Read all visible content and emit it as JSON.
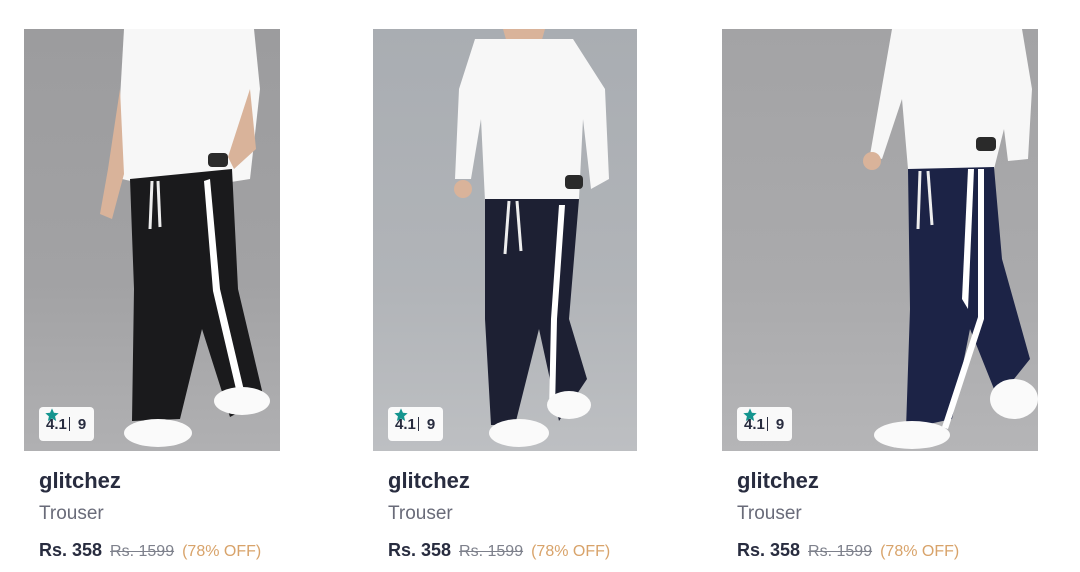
{
  "products": [
    {
      "rating": "4.1",
      "rating_count": "9",
      "brand": "glitchez",
      "type": "Trouser",
      "price": "Rs. 358",
      "mrp": "Rs. 1599",
      "discount": "(78% OFF)",
      "pant_color": "#1a1a1c",
      "shirt": "t-shirt"
    },
    {
      "rating": "4.1",
      "rating_count": "9",
      "brand": "glitchez",
      "type": "Trouser",
      "price": "Rs. 358",
      "mrp": "Rs. 1599",
      "discount": "(78% OFF)",
      "pant_color": "#1d2033",
      "shirt": "long-sleeve"
    },
    {
      "rating": "4.1",
      "rating_count": "9",
      "brand": "glitchez",
      "type": "Trouser",
      "price": "Rs. 358",
      "mrp": "Rs. 1599",
      "discount": "(78% OFF)",
      "pant_color": "#1c2346",
      "shirt": "long-sleeve"
    }
  ],
  "colors": {
    "star": "#14958f",
    "discount": "#d8a36a",
    "text_primary": "#282c3f",
    "text_secondary": "#696b79"
  },
  "icons": {
    "rating": "star-icon"
  }
}
